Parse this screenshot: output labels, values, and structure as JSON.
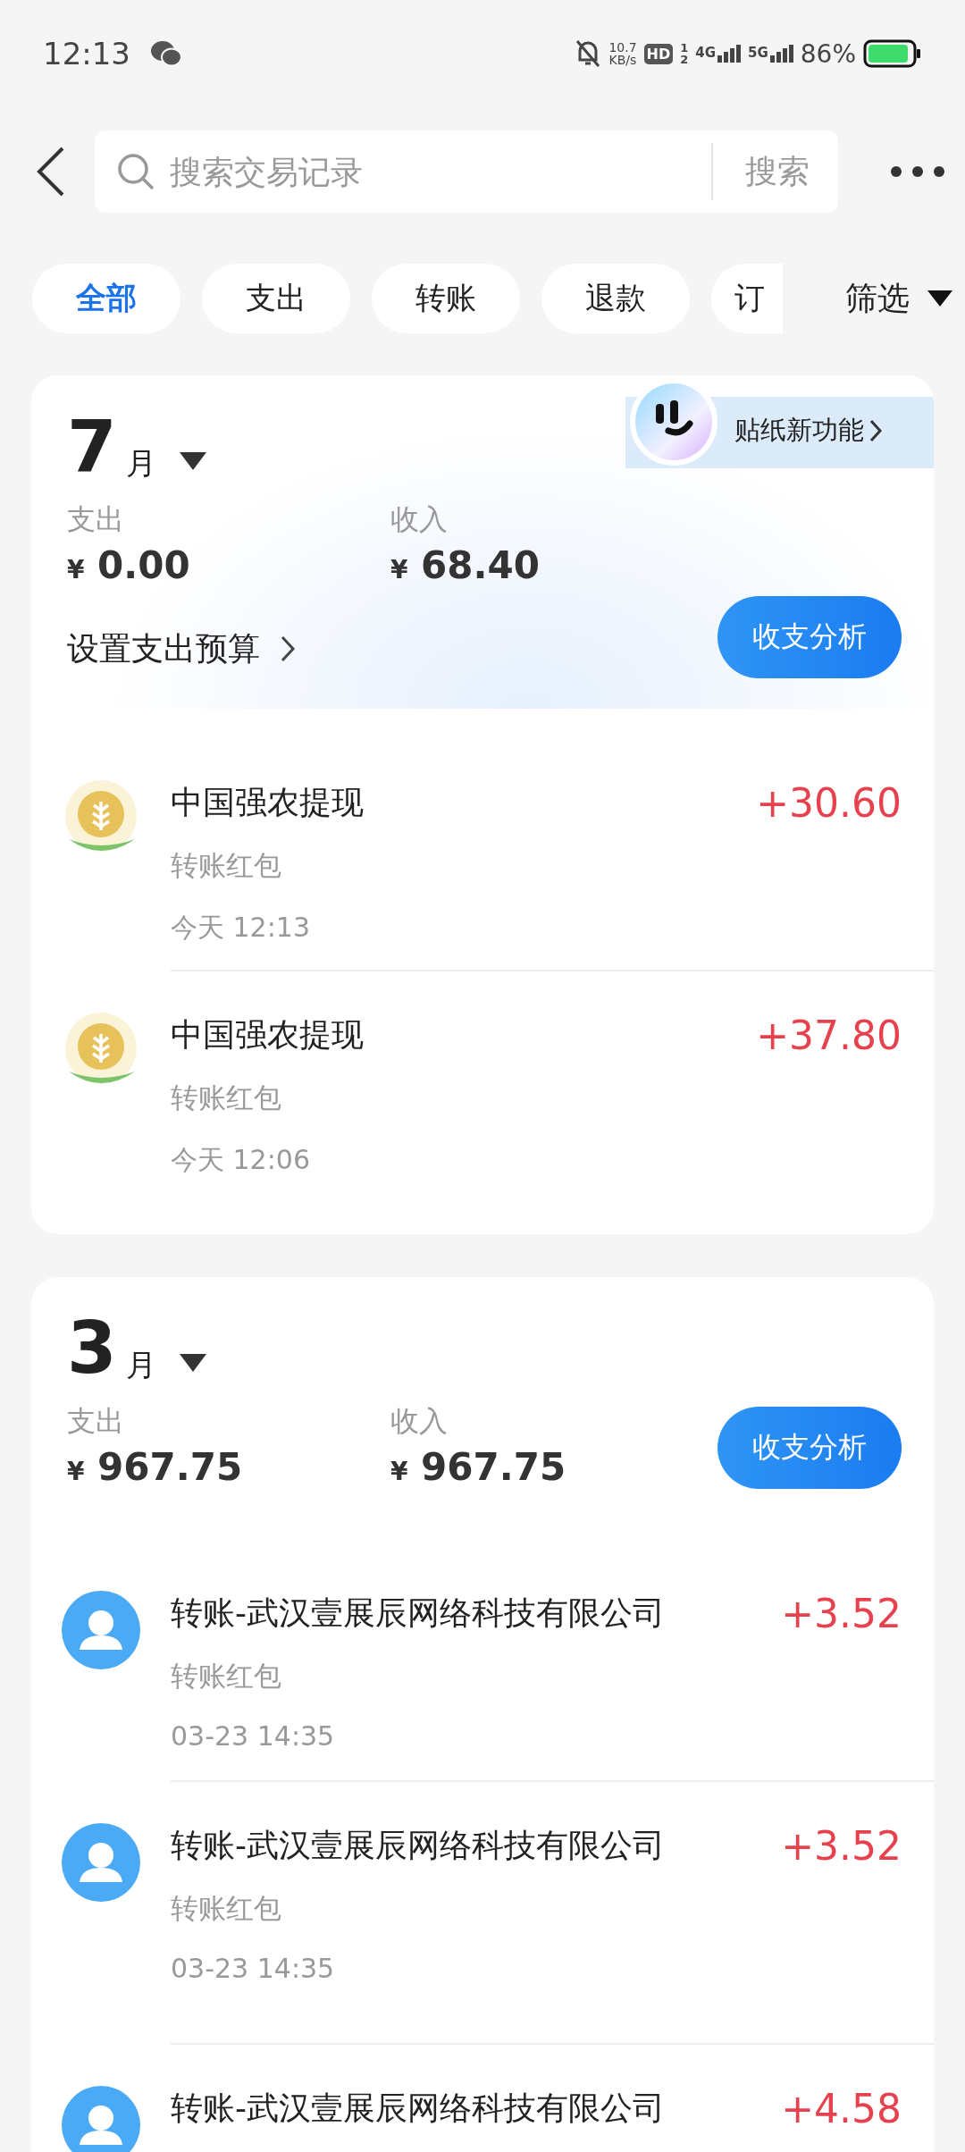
{
  "status_bar": {
    "time": "12:13",
    "speed": "10.7",
    "speed_unit": "KB/s",
    "hd": "HD",
    "sim_slots": [
      "1",
      "2"
    ],
    "network_1": "4G",
    "network_2": "5G",
    "battery": "86%"
  },
  "search": {
    "placeholder": "搜索交易记录",
    "button": "搜索"
  },
  "filters": [
    {
      "label": "全部",
      "selected": true
    },
    {
      "label": "支出",
      "selected": false
    },
    {
      "label": "转账",
      "selected": false
    },
    {
      "label": "退款",
      "selected": false
    },
    {
      "label": "订",
      "selected": false
    }
  ],
  "filter_button": "筛选",
  "months": [
    {
      "month": "7",
      "unit": "月",
      "sticker": "贴纸新功能",
      "expense_label": "支出",
      "currency": "¥",
      "expense": "0.00",
      "income_label": "收入",
      "income": "68.40",
      "budget_link": "设置支出预算",
      "analysis_button": "收支分析",
      "transactions": [
        {
          "kind": "wheat",
          "title": "中国强农提现",
          "subtitle": "转账红包",
          "time": "今天 12:13",
          "amount": "+30.60"
        },
        {
          "kind": "wheat",
          "title": "中国强农提现",
          "subtitle": "转账红包",
          "time": "今天 12:06",
          "amount": "+37.80"
        }
      ]
    },
    {
      "month": "3",
      "unit": "月",
      "expense_label": "支出",
      "currency": "¥",
      "expense": "967.75",
      "income_label": "收入",
      "income": "967.75",
      "analysis_button": "收支分析",
      "transactions": [
        {
          "kind": "person",
          "title": "转账-武汉壹展辰网络科技有限公司",
          "subtitle": "转账红包",
          "time": "03-23 14:35",
          "amount": "+3.52"
        },
        {
          "kind": "person",
          "title": "转账-武汉壹展辰网络科技有限公司",
          "subtitle": "转账红包",
          "time": "03-23 14:35",
          "amount": "+3.52"
        },
        {
          "kind": "person",
          "title": "转账-武汉壹展辰网络科技有限公司",
          "amount": "+4.58"
        }
      ]
    }
  ]
}
